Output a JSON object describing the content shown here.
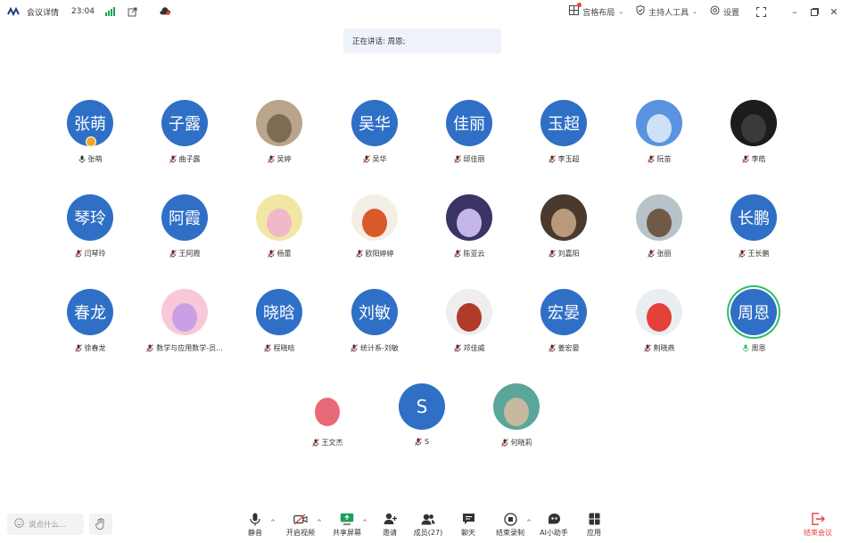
{
  "titlebar": {
    "title": "会议详情",
    "time": "23:04",
    "layout_label": "宫格布局",
    "host_tools_label": "主持人工具",
    "settings_label": "设置"
  },
  "speaking": {
    "text": "正在讲话: 周恩;"
  },
  "participants": [
    {
      "name": "张萌",
      "avatar_text": "张萌"
    },
    {
      "name": "曲子露",
      "avatar_text": "子露"
    },
    {
      "name": "吴婷",
      "avatar_text": ""
    },
    {
      "name": "吴华",
      "avatar_text": "吴华"
    },
    {
      "name": "邱佳丽",
      "avatar_text": "佳丽"
    },
    {
      "name": "李玉超",
      "avatar_text": "玉超"
    },
    {
      "name": "阮苗",
      "avatar_text": ""
    },
    {
      "name": "李皓",
      "avatar_text": ""
    },
    {
      "name": "闫琴玲",
      "avatar_text": "琴玲"
    },
    {
      "name": "王阿霞",
      "avatar_text": "阿霞"
    },
    {
      "name": "杨蕾",
      "avatar_text": ""
    },
    {
      "name": "欧阳婷婷",
      "avatar_text": ""
    },
    {
      "name": "陈亚云",
      "avatar_text": ""
    },
    {
      "name": "刘嘉阳",
      "avatar_text": ""
    },
    {
      "name": "张丽",
      "avatar_text": ""
    },
    {
      "name": "王长鹏",
      "avatar_text": "长鹏"
    },
    {
      "name": "徐春龙",
      "avatar_text": "春龙"
    },
    {
      "name": "数学与应用数学-员...",
      "avatar_text": ""
    },
    {
      "name": "程晓晗",
      "avatar_text": "晓晗"
    },
    {
      "name": "统计系-刘敏",
      "avatar_text": "刘敏"
    },
    {
      "name": "邓佳威",
      "avatar_text": ""
    },
    {
      "name": "姜宏晏",
      "avatar_text": "宏晏"
    },
    {
      "name": "荆晓燕",
      "avatar_text": ""
    },
    {
      "name": "周恩",
      "avatar_text": "周恩"
    },
    {
      "name": "王文杰",
      "avatar_text": ""
    },
    {
      "name": "S",
      "avatar_text": "S"
    },
    {
      "name": "何晓莉",
      "avatar_text": ""
    }
  ],
  "toolbar": {
    "say_placeholder": "说点什么...",
    "mute": "静音",
    "video": "开启视频",
    "share": "共享屏幕",
    "invite": "邀请",
    "members": "成员(27)",
    "chat": "聊天",
    "record": "结束录制",
    "ai": "AI小助手",
    "apps": "应用",
    "end": "结束会议"
  },
  "colors": {
    "avatar_blue": "#2f6fc6",
    "speaking_ring": "#2ebd6b",
    "end_red": "#e5413a",
    "banner_bg": "#eef3fb"
  }
}
